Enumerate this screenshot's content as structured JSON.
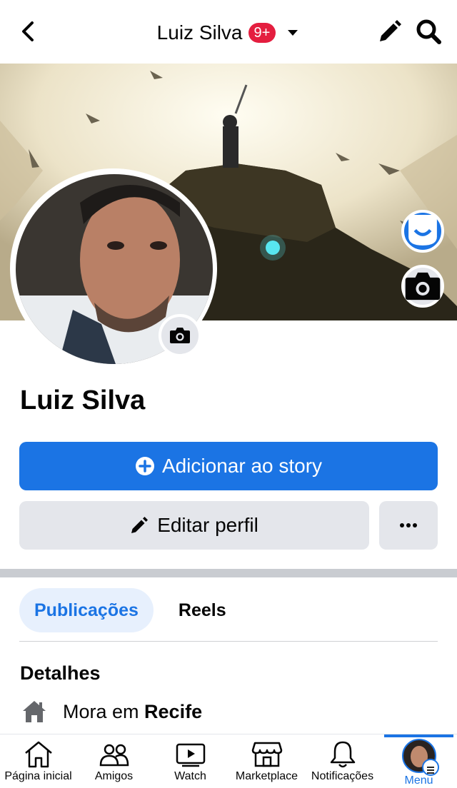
{
  "header": {
    "title": "Luiz Silva",
    "badge": "9+"
  },
  "profile": {
    "name": "Luiz Silva"
  },
  "buttons": {
    "add_story": "Adicionar ao story",
    "edit_profile": "Editar perfil",
    "more": "..."
  },
  "tabs": [
    {
      "label": "Publicações",
      "active": true
    },
    {
      "label": "Reels",
      "active": false
    }
  ],
  "details": {
    "title": "Detalhes",
    "lives_prefix": "Mora em",
    "lives_city": "Recife"
  },
  "bottom_nav": [
    {
      "label": "Página inicial",
      "icon": "home-icon"
    },
    {
      "label": "Amigos",
      "icon": "friends-icon"
    },
    {
      "label": "Watch",
      "icon": "watch-icon"
    },
    {
      "label": "Marketplace",
      "icon": "marketplace-icon"
    },
    {
      "label": "Notificações",
      "icon": "bell-icon"
    },
    {
      "label": "Menu",
      "icon": "menu-avatar",
      "active": true
    }
  ],
  "colors": {
    "accent": "#1b74e4",
    "badge": "#e41e3f",
    "button_gray": "#e4e6eb",
    "tab_active_bg": "#e7f0fd"
  }
}
